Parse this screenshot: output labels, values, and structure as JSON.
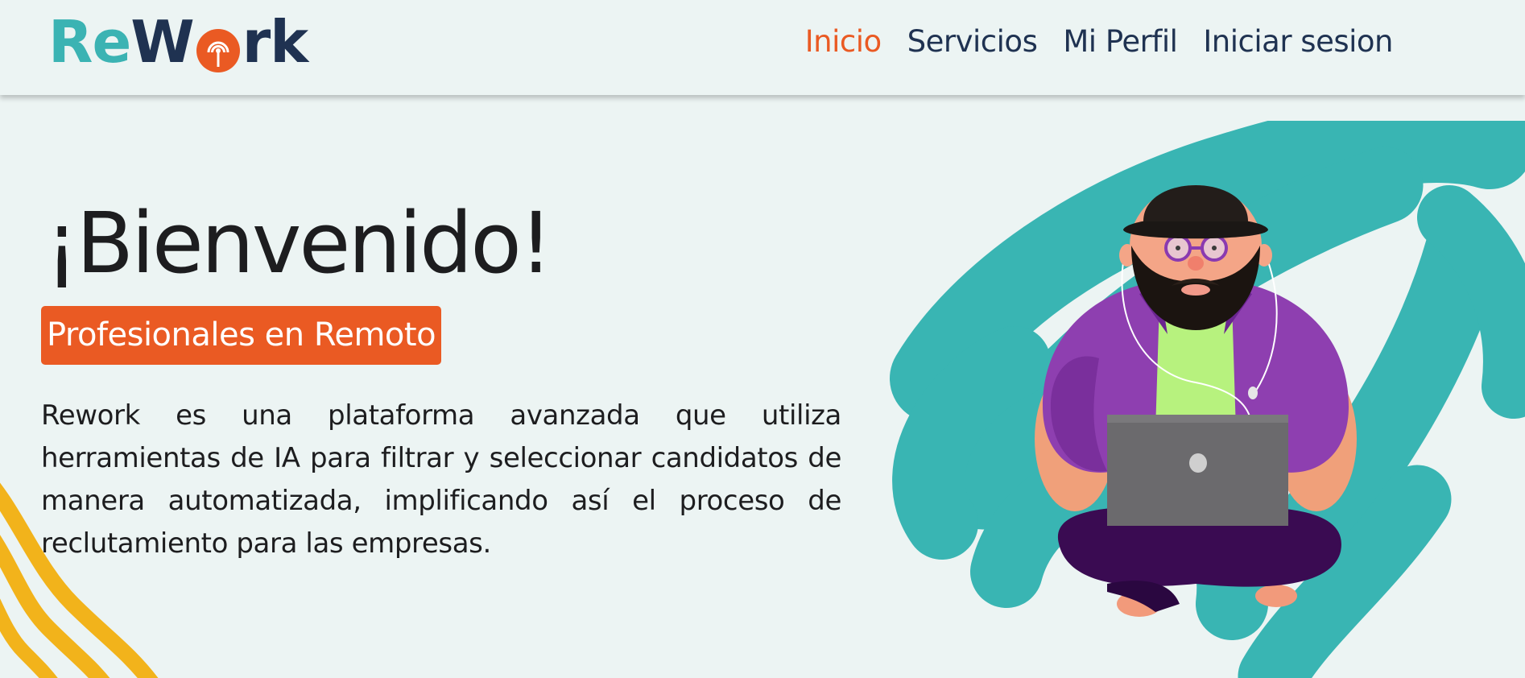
{
  "logo": {
    "part1": "Re",
    "part2": "W",
    "part3": "rk",
    "alt": "ReWork"
  },
  "nav": {
    "items": [
      {
        "label": "Inicio",
        "active": true
      },
      {
        "label": "Servicios",
        "active": false
      },
      {
        "label": "Mi Perfil",
        "active": false
      },
      {
        "label": "Iniciar sesion",
        "active": false
      }
    ]
  },
  "hero": {
    "title": "¡Bienvenido!",
    "badge": "Profesionales en Remoto",
    "description": "Rework es una plataforma avanzada que utiliza herramientas de IA para filtrar y seleccionar candidatos de manera automatizada, implificando así el proceso de reclutamiento para las empresas."
  },
  "colors": {
    "accent": "#ea5a23",
    "navy": "#1f3251",
    "teal": "#3bb3b3",
    "yellow": "#f2b31b",
    "background": "#ecf4f3"
  },
  "icons": {
    "logo_o": "broadcast-signal-icon",
    "illustration": "remote-worker-laptop-illustration"
  }
}
